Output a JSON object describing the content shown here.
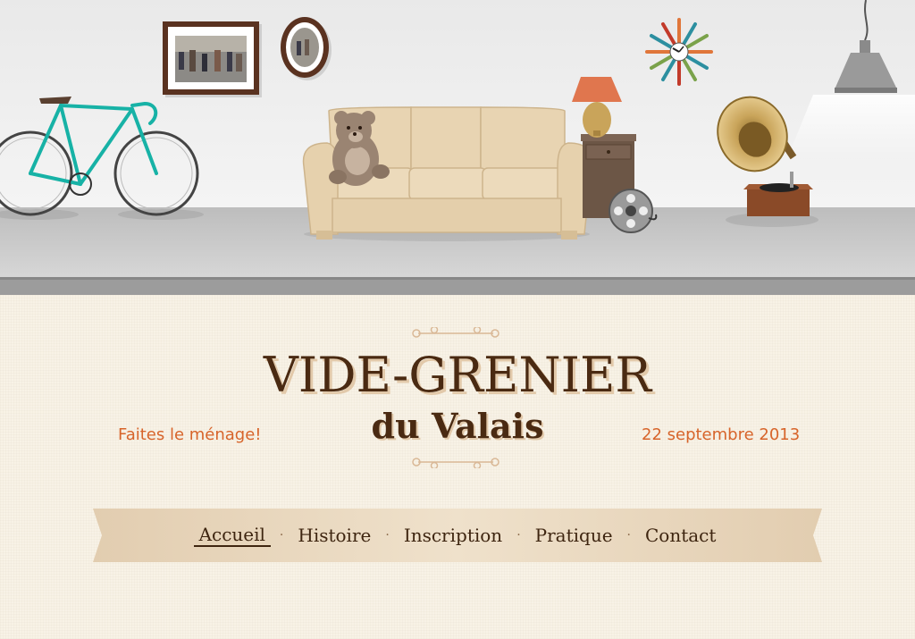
{
  "site": {
    "title": "VIDE-GRENIER",
    "subtitle": "du Valais",
    "tagline": "Faites le ménage!",
    "date": "22 septembre 2013"
  },
  "nav": {
    "items": [
      {
        "label": "Accueil",
        "active": true
      },
      {
        "label": "Histoire",
        "active": false
      },
      {
        "label": "Inscription",
        "active": false
      },
      {
        "label": "Pratique",
        "active": false
      },
      {
        "label": "Contact",
        "active": false
      }
    ],
    "separator": "·"
  },
  "colors": {
    "title": "#4a2a12",
    "accent": "#d7642a",
    "ribbon": "#e6d3b8",
    "bike": "#17b2a6"
  },
  "hero_icons": [
    "framed-photo-icon",
    "oval-photo-icon",
    "bicycle-icon",
    "sofa-icon",
    "teddy-bear-icon",
    "table-lamp-icon",
    "nightstand-icon",
    "film-reel-icon",
    "sunburst-clock-icon",
    "gramophone-icon",
    "pendant-lamp-icon"
  ]
}
